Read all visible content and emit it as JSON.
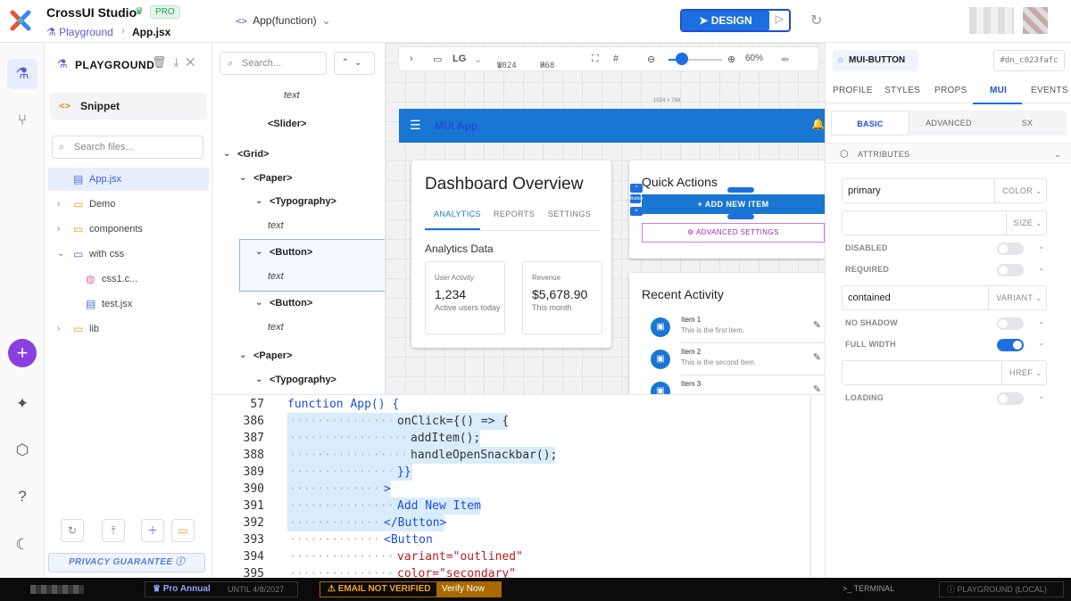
{
  "header": {
    "brand": "CrossUI Studio",
    "badge": "PRO",
    "breadcrumb_project": "Playground",
    "breadcrumb_file": "App.jsx",
    "function_selector": "App(function)",
    "design_label": "DESIGN"
  },
  "files": {
    "title": "PLAYGROUND",
    "snippet": "Snippet",
    "search_placeholder": "Search files...",
    "items": [
      {
        "name": "App.jsx",
        "type": "file",
        "selected": true
      },
      {
        "name": "Demo",
        "type": "folder"
      },
      {
        "name": "components",
        "type": "folder"
      },
      {
        "name": "with css",
        "type": "folder",
        "expanded": true
      },
      {
        "name": "css1.c...",
        "type": "css"
      },
      {
        "name": "test.jsx",
        "type": "file"
      },
      {
        "name": "lib",
        "type": "folder"
      }
    ],
    "privacy": "PRIVACY GUARANTEE"
  },
  "tree": {
    "search_placeholder": "Search...",
    "rows": [
      {
        "label": "text",
        "kind": "txt"
      },
      {
        "label": "<Slider>",
        "kind": "tag"
      },
      {
        "label": "<Grid>",
        "kind": "tag"
      },
      {
        "label": "<Paper>",
        "kind": "tag"
      },
      {
        "label": "<Typography>",
        "kind": "tag"
      },
      {
        "label": "text",
        "kind": "txt"
      },
      {
        "label": "<Button>",
        "kind": "tag"
      },
      {
        "label": "text",
        "kind": "txt"
      },
      {
        "label": "<Button>",
        "kind": "tag"
      },
      {
        "label": "text",
        "kind": "txt"
      },
      {
        "label": "<Paper>",
        "kind": "tag"
      },
      {
        "label": "<Typography>",
        "kind": "tag"
      }
    ]
  },
  "canvas": {
    "breakpoint": "LG",
    "width_label": "W",
    "width": "1024",
    "height_label": "H",
    "height": "768",
    "zoom": "60%",
    "zoom_fraction": 0.25,
    "dimensions": "1024 × 768",
    "app_title": "MUI App",
    "dashboard_title": "Dashboard Overview",
    "tabs": [
      "ANALYTICS",
      "REPORTS",
      "SETTINGS"
    ],
    "analytics_title": "Analytics Data",
    "stats": [
      {
        "label": "User Activity",
        "value": "1,234",
        "caption": "Active users today"
      },
      {
        "label": "Revenue",
        "value": "$5,678.90",
        "caption": "This month"
      }
    ],
    "quick_actions_title": "Quick Actions",
    "button_tag": "Button",
    "add_button": "ADD NEW ITEM",
    "advanced_button": "ADVANCED SETTINGS",
    "recent_title": "Recent Activity",
    "activities": [
      {
        "name": "Item 1",
        "desc": "This is the first item."
      },
      {
        "name": "Item 2",
        "desc": "This is the second item."
      },
      {
        "name": "Item 3",
        "desc": ""
      }
    ]
  },
  "code": {
    "header_line": "57",
    "header_text": "function App() {",
    "lines": [
      {
        "n": "386",
        "text": "onClick={() => {"
      },
      {
        "n": "387",
        "text": "addItem();"
      },
      {
        "n": "388",
        "text": "handleOpenSnackbar();"
      },
      {
        "n": "389",
        "text": "}}"
      },
      {
        "n": "390",
        "text": ">"
      },
      {
        "n": "391",
        "text": "Add New Item"
      },
      {
        "n": "392",
        "text": "</Button>"
      },
      {
        "n": "393",
        "text": "<Button"
      },
      {
        "n": "394",
        "text": "variant=\"outlined\""
      },
      {
        "n": "395",
        "text": "color=\"secondary\""
      }
    ]
  },
  "props": {
    "component": "MUI-BUTTON",
    "id": "#dn_c023fafc",
    "tabs": [
      "PROFILE",
      "STYLES",
      "PROPS",
      "MUI",
      "EVENTS"
    ],
    "active_tab": "MUI",
    "subtabs": [
      "BASIC",
      "ADVANCED",
      "SX"
    ],
    "section": "ATTRIBUTES",
    "color_value": "primary",
    "color_label": "COLOR",
    "size_value": "",
    "size_label": "SIZE",
    "disabled_label": "DISABLED",
    "required_label": "REQUIRED",
    "variant_value": "contained",
    "variant_label": "VARIANT",
    "no_shadow_label": "NO SHADOW",
    "full_width_label": "FULL WIDTH",
    "href_value": "",
    "href_label": "HREF",
    "loading_label": "LOADING"
  },
  "status": {
    "plan": "Pro Annual",
    "plan_until": "UNTIL 4/8/2027",
    "email_warning": "EMAIL NOT VERIFIED",
    "verify": "Verify Now →",
    "terminal": "TERMINAL",
    "environment": "PLAYGROUND (LOCAL)"
  },
  "colors": {
    "accent": "#1d6fe0",
    "mui_primary": "#1976d2",
    "mui_secondary": "#9c27b0",
    "warning": "#f5a623"
  }
}
